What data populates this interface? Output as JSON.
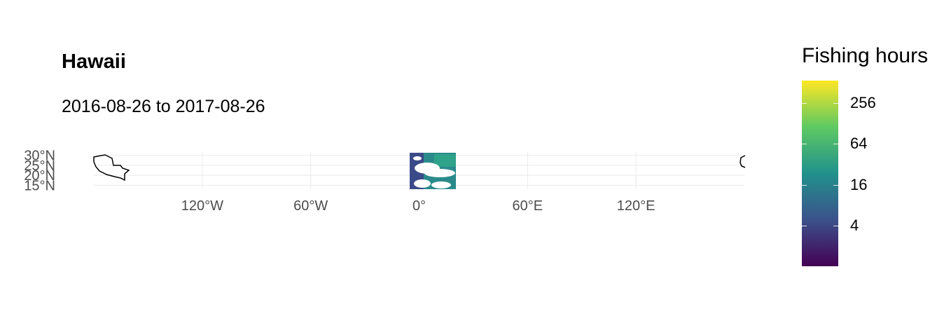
{
  "title": "Hawaii",
  "subtitle": "2016-08-26 to 2017-08-26",
  "legend": {
    "title": "Fishing hours",
    "scale": "log",
    "palette": [
      "#440154",
      "#3b528b",
      "#21918c",
      "#5ec962",
      "#fde725"
    ],
    "ticks": [
      {
        "label": "256",
        "value": 256
      },
      {
        "label": "64",
        "value": 64
      },
      {
        "label": "16",
        "value": 16
      },
      {
        "label": "4",
        "value": 4
      }
    ]
  },
  "map": {
    "x_ticks": [
      {
        "label": "120°W",
        "lon": -120
      },
      {
        "label": "60°W",
        "lon": -60
      },
      {
        "label": "0°",
        "lon": 0
      },
      {
        "label": "60°E",
        "lon": 60
      },
      {
        "label": "120°E",
        "lon": 120
      }
    ],
    "y_ticks": [
      {
        "label": "30°N",
        "lat": 30
      },
      {
        "label": "25°N",
        "lat": 25
      },
      {
        "label": "20°N",
        "lat": 20
      },
      {
        "label": "15°N",
        "lat": 15
      }
    ],
    "lon_range": [
      -180,
      180
    ],
    "lat_range": [
      13,
      32
    ],
    "grid": true,
    "outline_color": "#000000",
    "gridline_color": "#ebebeb"
  }
}
